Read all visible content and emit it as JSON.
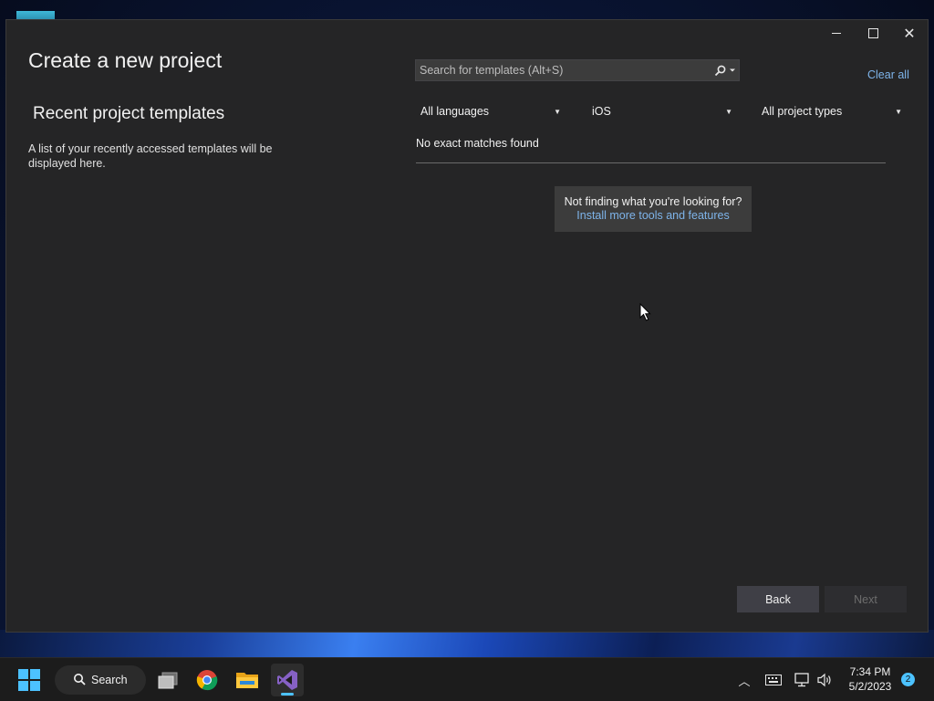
{
  "dialog": {
    "title": "Create a new project",
    "recent": {
      "heading": "Recent project templates",
      "description": "A list of your recently accessed templates will be displayed here."
    },
    "search": {
      "placeholder": "Search for templates (Alt+S)",
      "icon": "search-icon"
    },
    "clear_all_label": "Clear all",
    "filters": {
      "language": "All languages",
      "platform": "iOS",
      "project_type": "All project types"
    },
    "results_message": "No exact matches found",
    "help": {
      "question": "Not finding what you're looking for?",
      "link": "Install more tools and features"
    },
    "buttons": {
      "back": "Back",
      "next": "Next"
    },
    "window_controls": [
      "minimize",
      "maximize",
      "close"
    ]
  },
  "taskbar": {
    "search_label": "Search",
    "apps": [
      "task-view",
      "chrome",
      "file-explorer",
      "visual-studio"
    ],
    "clock": {
      "time": "7:34 PM",
      "date": "5/2/2023"
    },
    "notification_count": "2"
  },
  "colors": {
    "dialog_bg": "#252526",
    "link": "#7eb4ea",
    "accent": "#4cc2ff",
    "vs_purple": "#8661c5"
  }
}
